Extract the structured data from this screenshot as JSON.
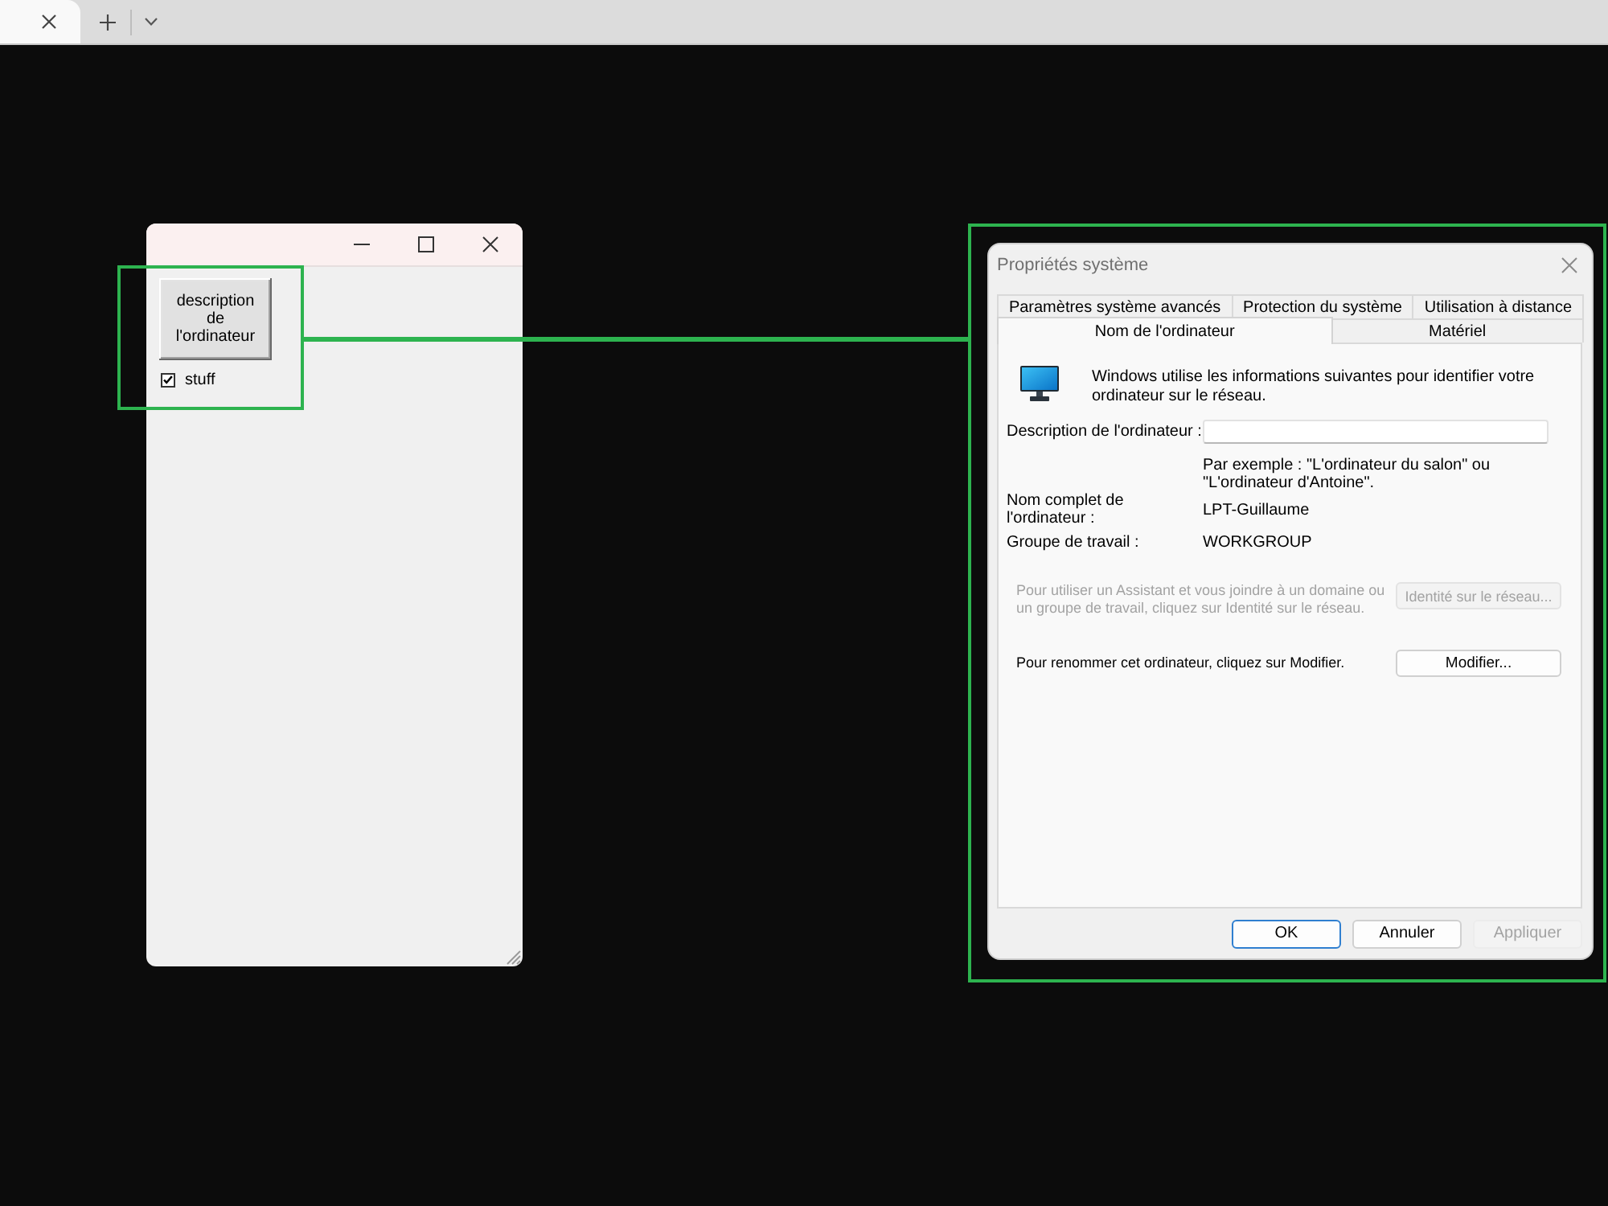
{
  "browser": {
    "tabs": [
      {
        "selected": true
      }
    ]
  },
  "small_window": {
    "button": "description de l'ordinateur",
    "checkbox": {
      "label": "stuff",
      "checked": true
    }
  },
  "dialog": {
    "title": "Propriétés système",
    "tab_rows": [
      [
        {
          "label": "Paramètres système avancés",
          "selected": false
        },
        {
          "label": "Protection du système",
          "selected": false
        },
        {
          "label": "Utilisation à distance",
          "selected": false
        }
      ],
      [
        {
          "label": "Nom de l'ordinateur",
          "selected": true
        },
        {
          "label": "Matériel",
          "selected": false
        }
      ]
    ],
    "intro": "Windows utilise les informations suivantes pour identifier votre ordinateur sur le réseau.",
    "description_field": {
      "label": "Description de l'ordinateur :"
    },
    "hint": "Par exemple : \"L'ordinateur du salon\" ou \"L'ordinateur d'Antoine\".",
    "info": [
      {
        "label": "Nom complet de l'ordinateur :",
        "value": "LPT-Guillaume"
      },
      {
        "label": "Groupe de travail :",
        "value": "WORKGROUP"
      }
    ],
    "actions": [
      {
        "text": "Pour utiliser un Assistant et vous joindre à un domaine ou un groupe de travail, cliquez sur Identité sur le réseau.",
        "button": "Identité sur le réseau...",
        "disabled": true
      },
      {
        "text": "Pour renommer cet ordinateur, cliquez sur Modifier.",
        "button": "Modifier...",
        "disabled": false
      }
    ],
    "buttons": [
      {
        "label": "OK",
        "default": true,
        "disabled": false
      },
      {
        "label": "Annuler",
        "default": false,
        "disabled": false
      },
      {
        "label": "Appliquer",
        "default": false,
        "disabled": true
      }
    ]
  }
}
